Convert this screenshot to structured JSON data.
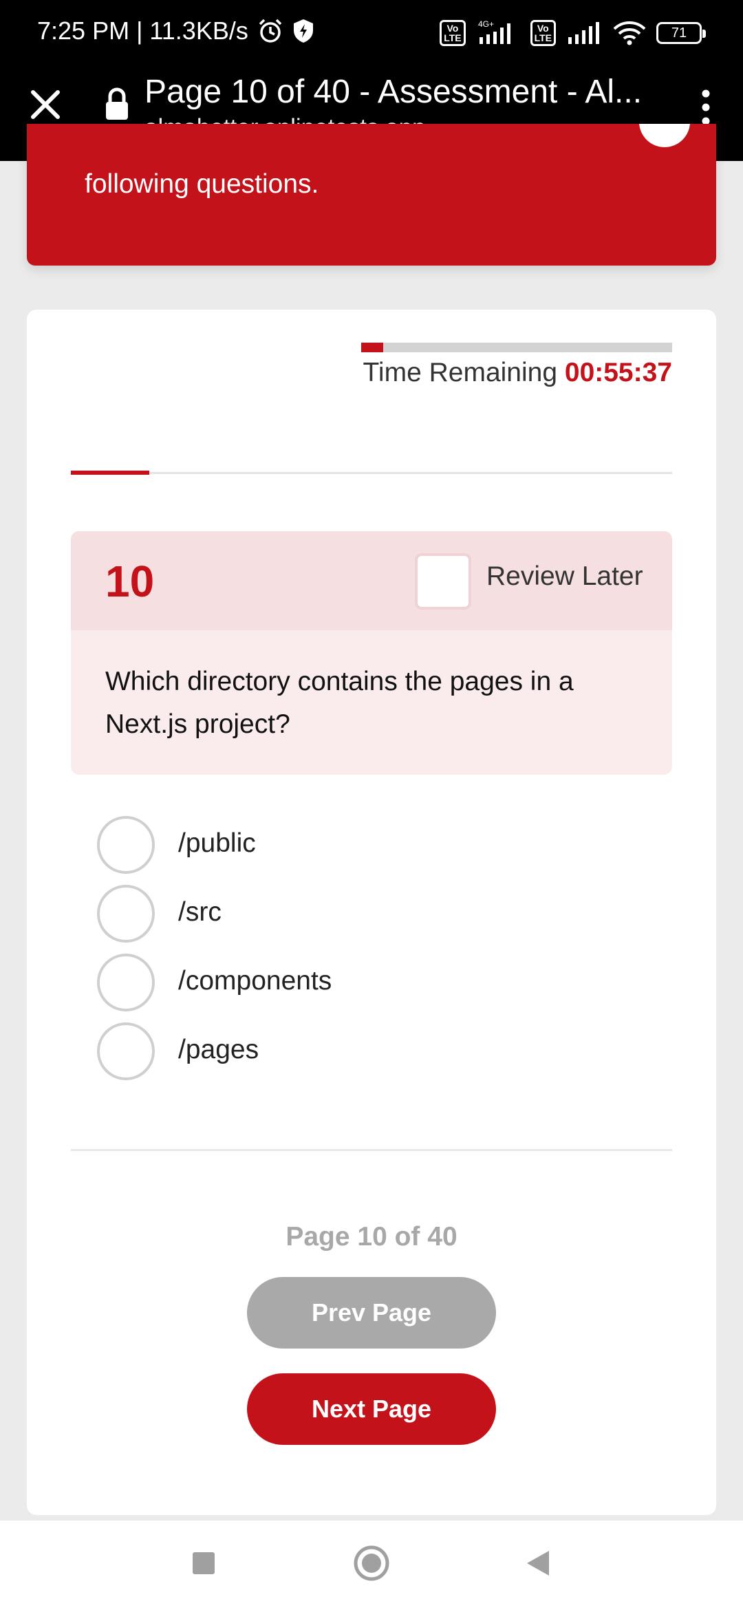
{
  "status_bar": {
    "time_speed": "7:25 PM | 11.3KB/s",
    "network_label": "4G+",
    "lte_badge": "Vo\nLTE",
    "battery": "71"
  },
  "browser": {
    "title": "Page 10 of 40 - Assessment - Al...",
    "url": "almabetter.onlinetests.app"
  },
  "banner": {
    "text": "following questions."
  },
  "timer": {
    "label": "Time Remaining",
    "value": "00:55:37",
    "progress_fraction": 0.07
  },
  "section_progress_fraction": 0.13,
  "question": {
    "number": "10",
    "review_label": "Review Later",
    "text": "Which directory contains the pages in a Next.js project?",
    "options": [
      "/public",
      "/src",
      "/components",
      "/pages"
    ]
  },
  "pagination": {
    "counter": "Page 10 of 40",
    "prev_label": "Prev Page",
    "next_label": "Next Page"
  },
  "colors": {
    "accent": "#c4121a",
    "disabled": "#a9a9a9"
  }
}
